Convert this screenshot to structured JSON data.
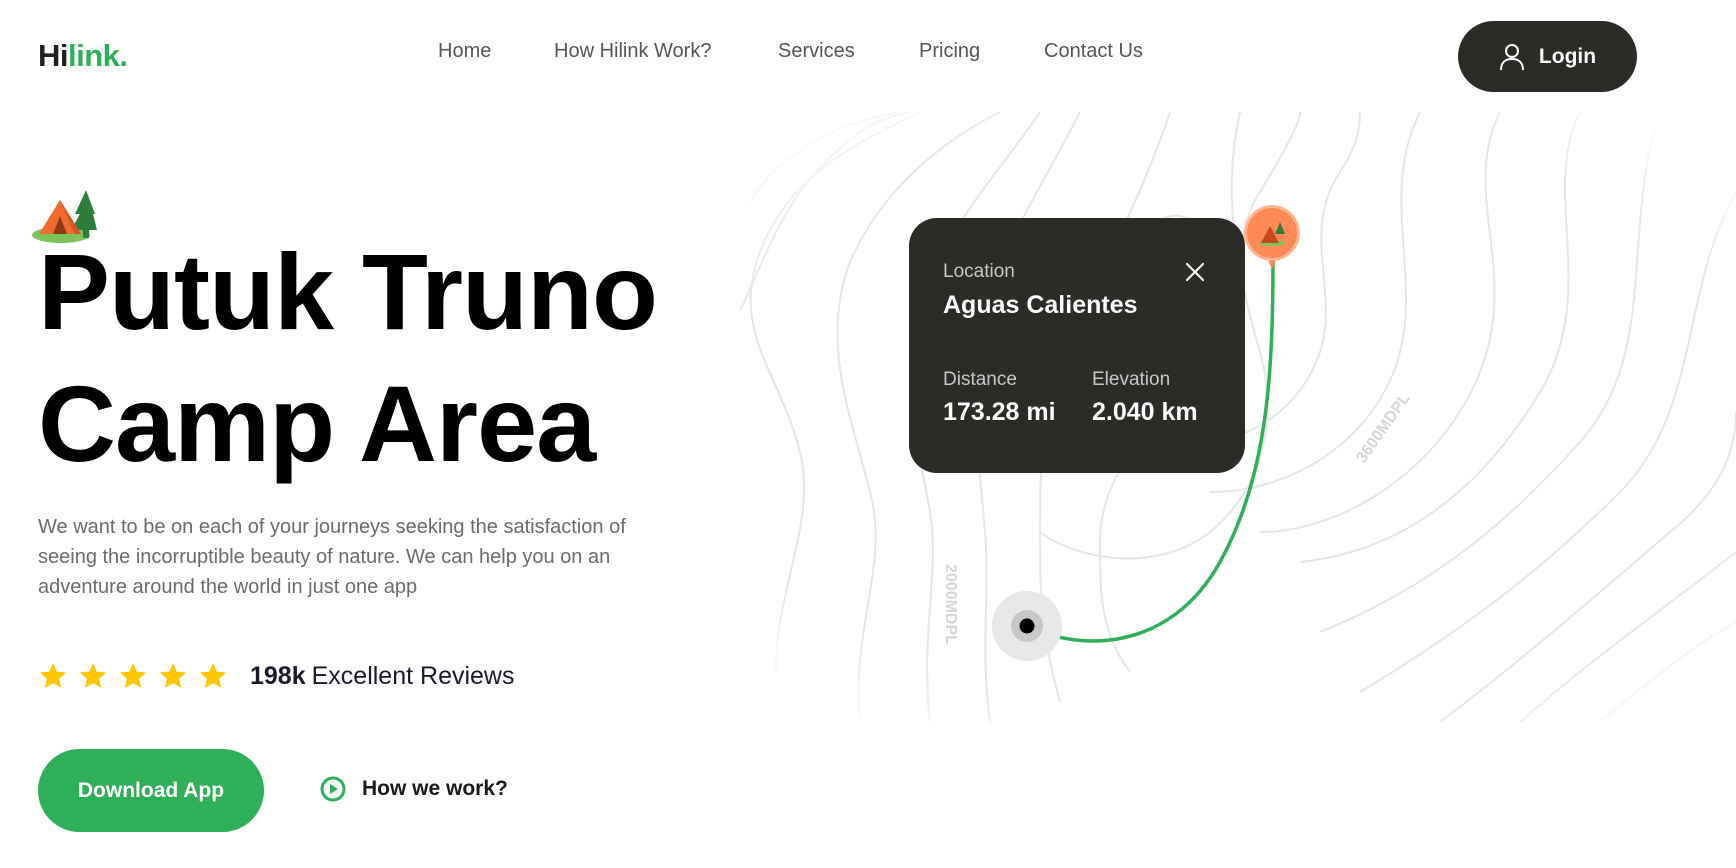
{
  "header": {
    "logo_part1": "Hi",
    "logo_part2": "link.",
    "nav": [
      {
        "label": "Home"
      },
      {
        "label": "How Hilink Work?"
      },
      {
        "label": "Services"
      },
      {
        "label": "Pricing"
      },
      {
        "label": "Contact Us"
      }
    ],
    "login_label": "Login"
  },
  "hero": {
    "title_line1": "Putuk Truno",
    "title_line2": "Camp Area",
    "description": "We want to be on each of your journeys seeking the satisfaction of seeing the incorruptible beauty of nature. We can help you on an adventure around the world in just one app",
    "rating": {
      "stars": 5,
      "count": "198k",
      "label": "Excellent Reviews"
    },
    "download_label": "Download App",
    "how_label": "How we work?"
  },
  "map": {
    "contour_label_1": "2000MDPL",
    "contour_label_2": "3600MDPL"
  },
  "card": {
    "location_label": "Location",
    "location_value": "Aguas Calientes",
    "distance_label": "Distance",
    "distance_value": "173.28 mi",
    "elevation_label": "Elevation",
    "elevation_value": "2.040 km"
  },
  "colors": {
    "brand_green": "#30af5b",
    "dark": "#292c27",
    "star": "#fdc500",
    "pin": "#ff814c"
  },
  "icons": [
    "user-icon",
    "tent-icon",
    "star-icon",
    "close-icon",
    "play-icon",
    "pin-icon"
  ]
}
